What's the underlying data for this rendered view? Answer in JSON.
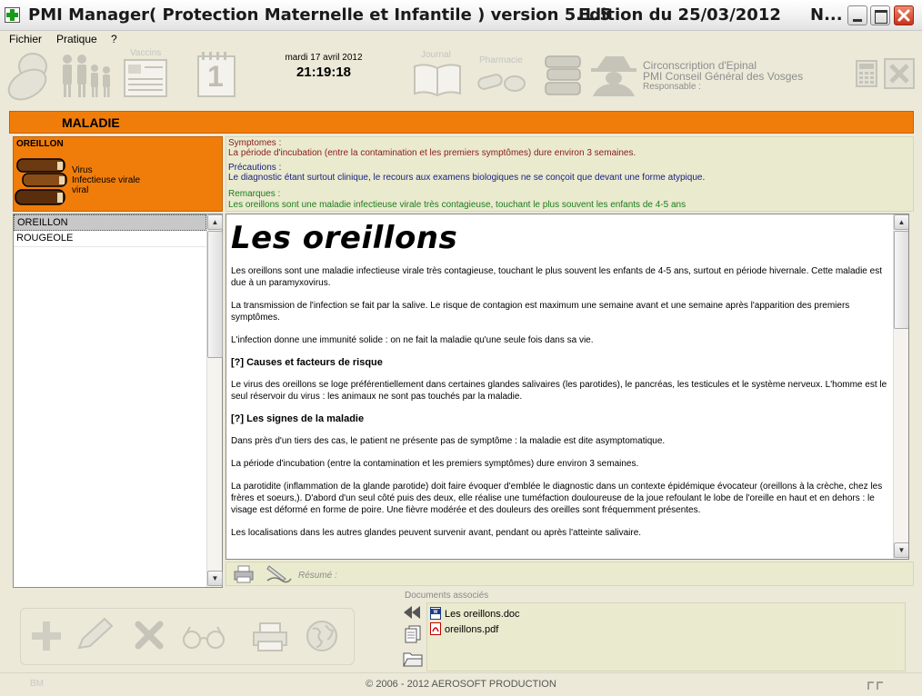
{
  "window": {
    "title": "PMI Manager( Protection Maternelle et Infantile )  version 5.1.5",
    "edition": "Edition du 25/03/2012",
    "title_trunc": "N..."
  },
  "menu": [
    "Fichier",
    "Pratique",
    "?"
  ],
  "toolbar": {
    "vaccins_label": "Vaccins",
    "calendar_day": "1",
    "date": "mardi 17 avril 2012",
    "time": "21:19:18",
    "journal_label": "Journal",
    "pharmacie_label": "Pharmacie",
    "org_line1": "Circonscription d'Epinal",
    "org_line2": "PMI Conseil Général des Vosges",
    "org_line3": "Responsable :"
  },
  "section_title": "MALADIE",
  "disease": {
    "name": "OREILLON",
    "type_line1": "Virus",
    "type_line2": "Infectieuse virale",
    "type_line3": "viral"
  },
  "info": {
    "symptomes_label": "Symptomes :",
    "symptomes_text": "La période d'incubation (entre la contamination et les premiers symptômes) dure environ 3 semaines.",
    "precautions_label": "Précautions :",
    "precautions_text": "Le diagnostic étant surtout clinique, le recours aux examens biologiques ne se conçoit que devant une forme atypique.",
    "remarques_label": "Remarques :",
    "remarques_text": "Les oreillons sont une maladie infectieuse virale très contagieuse, touchant le plus souvent les enfants de 4-5 ans",
    "colors": {
      "symptomes": "#8b1a1a",
      "precautions": "#1a237e",
      "remarques": "#1b7d1b"
    }
  },
  "disease_list": [
    "OREILLON",
    "ROUGEOLE"
  ],
  "doc": {
    "title": "Les oreillons",
    "p1": "Les oreillons sont une maladie infectieuse virale très contagieuse, touchant le plus souvent les enfants de 4-5 ans, surtout en période hivernale. Cette maladie est due à un paramyxovirus.",
    "p2": "La transmission de l'infection se fait par la salive. Le risque de contagion est maximum une semaine avant et une semaine après l'apparition des premiers symptômes.",
    "p3": "L'infection donne une immunité solide : on ne fait la maladie qu'une seule fois dans sa vie.",
    "h_causes": "[?] Causes et facteurs de risque",
    "p4": "Le virus des oreillons se loge préférentiellement dans certaines glandes salivaires (les parotides), le pancréas, les testicules et le système nerveux. L'homme est le seul réservoir du virus : les animaux ne sont pas touchés par la maladie.",
    "h_signes": "[?] Les signes de la maladie",
    "p5": "Dans près d'un tiers des cas, le patient ne présente pas de symptôme : la maladie est dite asymptomatique.",
    "p6": "La période d'incubation (entre la contamination et les premiers symptômes) dure environ 3 semaines.",
    "p7": "La parotidite (inflammation de la glande parotide) doit faire évoquer d'emblée le diagnostic dans un contexte épidémique évocateur (oreillons à la crèche, chez les frères et soeurs,). D'abord d'un seul côté puis des deux, elle réalise une tuméfaction douloureuse de la joue refoulant le lobe de l'oreille en haut et en dehors : le visage est déformé en forme de poire. Une fièvre modérée et des douleurs des oreilles sont fréquemment présentes.",
    "p8": "Les localisations dans les autres glandes peuvent survenir avant, pendant ou après l'atteinte salivaire."
  },
  "resume_label": "Résumé :",
  "docs_assoc": {
    "title": "Documents associés",
    "files": [
      "Les oreillons.doc",
      "oreillons.pdf"
    ]
  },
  "footer": {
    "copyright": "© 2006 - 2012  AEROSOFT PRODUCTION",
    "initials": "BM"
  },
  "colors": {
    "accent_orange": "#f07d0a",
    "panel_beige": "#eaeacf",
    "window_bg": "#ece9d8"
  }
}
